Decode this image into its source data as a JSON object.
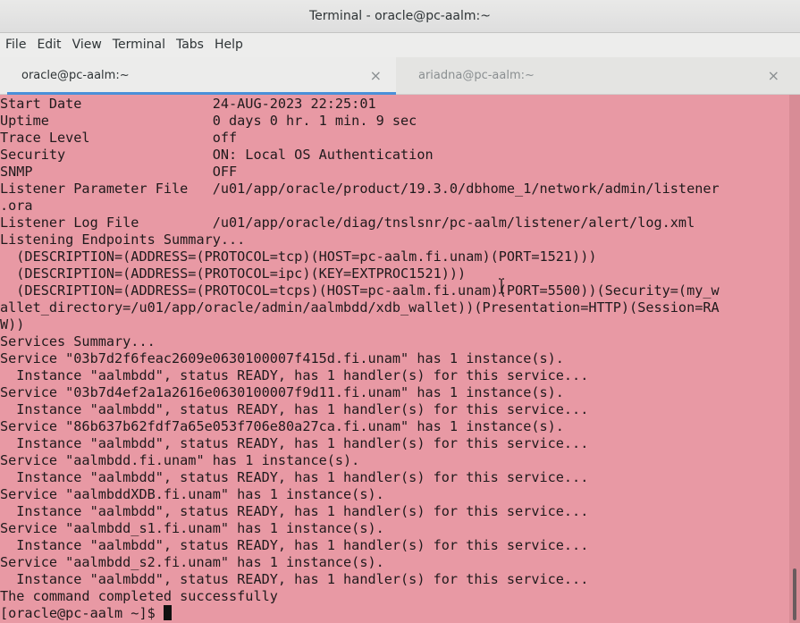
{
  "window": {
    "title": "Terminal - oracle@pc-aalm:~"
  },
  "menubar": {
    "items": [
      "File",
      "Edit",
      "View",
      "Terminal",
      "Tabs",
      "Help"
    ]
  },
  "tabs": [
    {
      "label": "oracle@pc-aalm:~",
      "close": "×",
      "active": true
    },
    {
      "label": "ariadna@pc-aalm:~",
      "close": "×",
      "active": false
    }
  ],
  "terminal": {
    "lines": [
      "Start Date                24-AUG-2023 22:25:01",
      "Uptime                    0 days 0 hr. 1 min. 9 sec",
      "Trace Level               off",
      "Security                  ON: Local OS Authentication",
      "SNMP                      OFF",
      "Listener Parameter File   /u01/app/oracle/product/19.3.0/dbhome_1/network/admin/listener",
      ".ora",
      "Listener Log File         /u01/app/oracle/diag/tnslsnr/pc-aalm/listener/alert/log.xml",
      "Listening Endpoints Summary...",
      "  (DESCRIPTION=(ADDRESS=(PROTOCOL=tcp)(HOST=pc-aalm.fi.unam)(PORT=1521)))",
      "  (DESCRIPTION=(ADDRESS=(PROTOCOL=ipc)(KEY=EXTPROC1521)))",
      "  (DESCRIPTION=(ADDRESS=(PROTOCOL=tcps)(HOST=pc-aalm.fi.unam)(PORT=5500))(Security=(my_w",
      "allet_directory=/u01/app/oracle/admin/aalmbdd/xdb_wallet))(Presentation=HTTP)(Session=RA",
      "W))",
      "Services Summary...",
      "Service \"03b7d2f6feac2609e0630100007f415d.fi.unam\" has 1 instance(s).",
      "  Instance \"aalmbdd\", status READY, has 1 handler(s) for this service...",
      "Service \"03b7d4ef2a1a2616e0630100007f9d11.fi.unam\" has 1 instance(s).",
      "  Instance \"aalmbdd\", status READY, has 1 handler(s) for this service...",
      "Service \"86b637b62fdf7a65e053f706e80a27ca.fi.unam\" has 1 instance(s).",
      "  Instance \"aalmbdd\", status READY, has 1 handler(s) for this service...",
      "Service \"aalmbdd.fi.unam\" has 1 instance(s).",
      "  Instance \"aalmbdd\", status READY, has 1 handler(s) for this service...",
      "Service \"aalmbddXDB.fi.unam\" has 1 instance(s).",
      "  Instance \"aalmbdd\", status READY, has 1 handler(s) for this service...",
      "Service \"aalmbdd_s1.fi.unam\" has 1 instance(s).",
      "  Instance \"aalmbdd\", status READY, has 1 handler(s) for this service...",
      "Service \"aalmbdd_s2.fi.unam\" has 1 instance(s).",
      "  Instance \"aalmbdd\", status READY, has 1 handler(s) for this service...",
      "The command completed successfully"
    ],
    "prompt": "[oracle@pc-aalm ~]$ ",
    "background": "#e899a4",
    "foreground": "#201a1c"
  },
  "colors": {
    "tab_accent": "#4a90d9"
  },
  "icons": {
    "tab_close": "close-icon",
    "mouse_cursor": "text-cursor-icon"
  }
}
